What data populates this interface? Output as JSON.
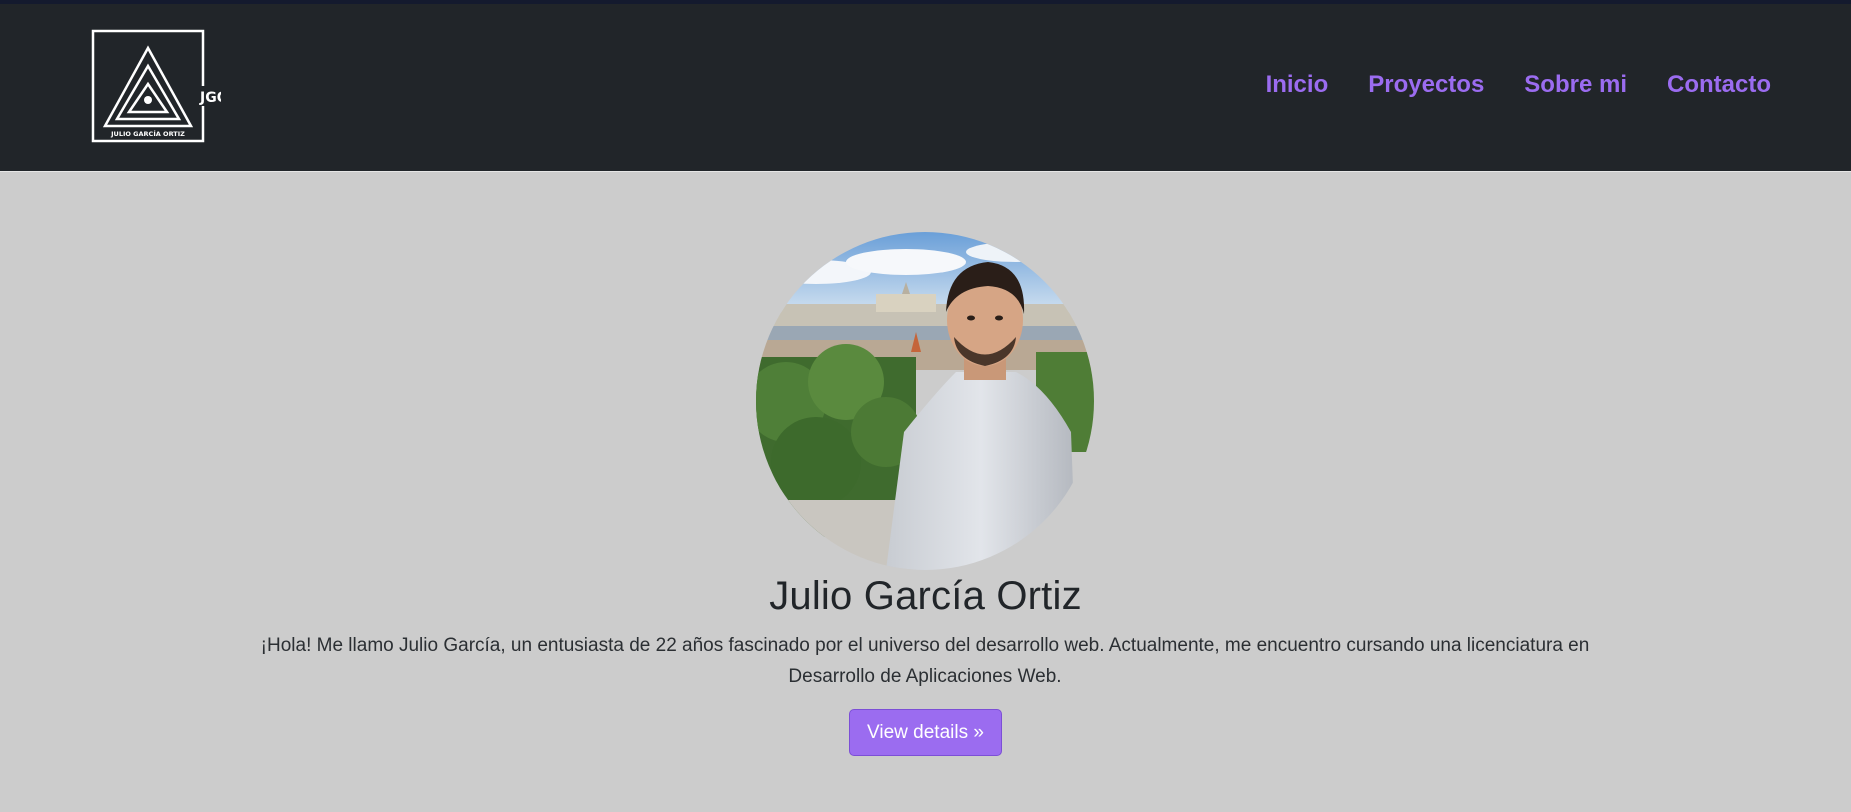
{
  "header": {
    "logo": {
      "initials": "JGO",
      "caption": "JULIO GARCÍA ORTIZ"
    },
    "nav": [
      {
        "label": "Inicio"
      },
      {
        "label": "Proyectos"
      },
      {
        "label": "Sobre mi"
      },
      {
        "label": "Contacto"
      }
    ]
  },
  "hero": {
    "name": "Julio García Ortiz",
    "bio": "¡Hola! Me llamo Julio García, un entusiasta de 22 años fascinado por el universo del desarrollo web. Actualmente, me encuentro cursando una licenciatura en Desarrollo de Aplicaciones Web.",
    "button_label": "View details »"
  },
  "colors": {
    "navbar_bg": "#212529",
    "page_bg": "#cccccc",
    "accent": "#9b6cf0",
    "text": "#212529"
  }
}
